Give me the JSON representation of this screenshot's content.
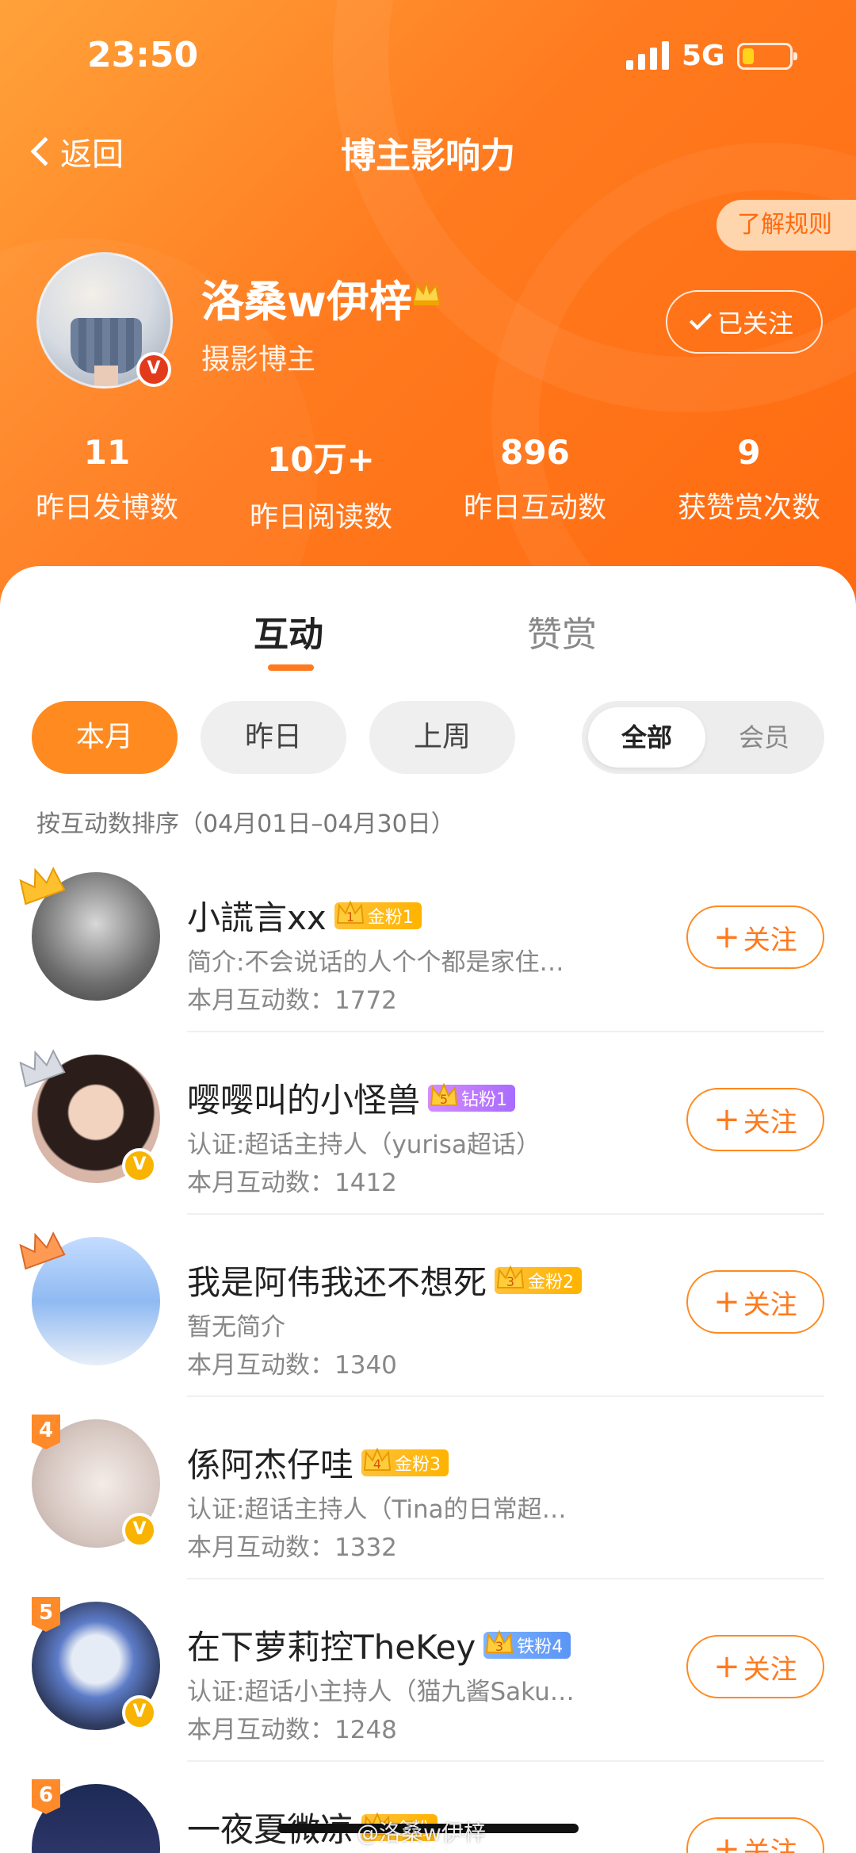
{
  "status": {
    "time": "23:50",
    "network": "5G"
  },
  "nav": {
    "back_label": "返回",
    "title": "博主影响力",
    "rules_label": "了解规则"
  },
  "profile": {
    "name": "洛桑w伊梓",
    "subtitle": "摄影博主",
    "follow_state": "已关注",
    "verified_badge": "V"
  },
  "stats": [
    {
      "value": "11",
      "label": "昨日发博数"
    },
    {
      "value": "10万+",
      "label": "昨日阅读数"
    },
    {
      "value": "896",
      "label": "昨日互动数"
    },
    {
      "value": "9",
      "label": "获赞赏次数"
    }
  ],
  "tabs": {
    "hudong": "互动",
    "zanshang": "赞赏",
    "active": "互动"
  },
  "period_filters": {
    "month": "本月",
    "yesterday": "昨日",
    "last_week": "上周",
    "active": "本月"
  },
  "scope": {
    "all": "全部",
    "member": "会员",
    "active": "全部"
  },
  "sort_note": "按互动数排序（04月01日–04月30日）",
  "follow_label": "关注",
  "ranking": [
    {
      "rank": "1",
      "name": "小謊言xx",
      "fan_badge": "金粉1",
      "fan_type": "gold",
      "crown_level": "1",
      "bio": "简介:不会说话的人个个都是家住…",
      "count": "本月互动数：1772",
      "verified": false
    },
    {
      "rank": "2",
      "name": "嘤嘤叫的小怪兽",
      "fan_badge": "钻粉1",
      "fan_type": "diamond",
      "crown_level": "5",
      "bio": "认证:超话主持人（yurisa超话）",
      "count": "本月互动数：1412",
      "verified": true
    },
    {
      "rank": "3",
      "name": "我是阿伟我还不想死",
      "fan_badge": "金粉2",
      "fan_type": "gold",
      "crown_level": "3",
      "bio": "暂无简介",
      "count": "本月互动数：1340",
      "verified": false
    },
    {
      "rank": "4",
      "name": "係阿杰仔哇",
      "fan_badge": "金粉3",
      "fan_type": "gold",
      "crown_level": "4",
      "bio": "认证:超话主持人（Tina的日常超…",
      "count": "本月互动数：1332",
      "verified": true
    },
    {
      "rank": "5",
      "name": "在下萝莉控TheKey",
      "fan_badge": "铁粉4",
      "fan_type": "iron",
      "crown_level": "3",
      "bio": "认证:超话小主持人（猫九酱Saku…",
      "count": "本月互动数：1248",
      "verified": true
    },
    {
      "rank": "6",
      "name": "一夜夏微凉",
      "fan_badge": "金粉",
      "fan_type": "gold",
      "crown_level": "",
      "bio": "",
      "count": "",
      "verified": false
    }
  ],
  "watermark": "@洛桑w伊梓",
  "colors": {
    "accent": "#ff7a1e",
    "header_gradient_start": "#ffa23a",
    "header_gradient_end": "#ff6a10",
    "gold_badge": "#ffb300",
    "diamond_badge": "#a86bff",
    "iron_badge": "#5b95f5"
  }
}
